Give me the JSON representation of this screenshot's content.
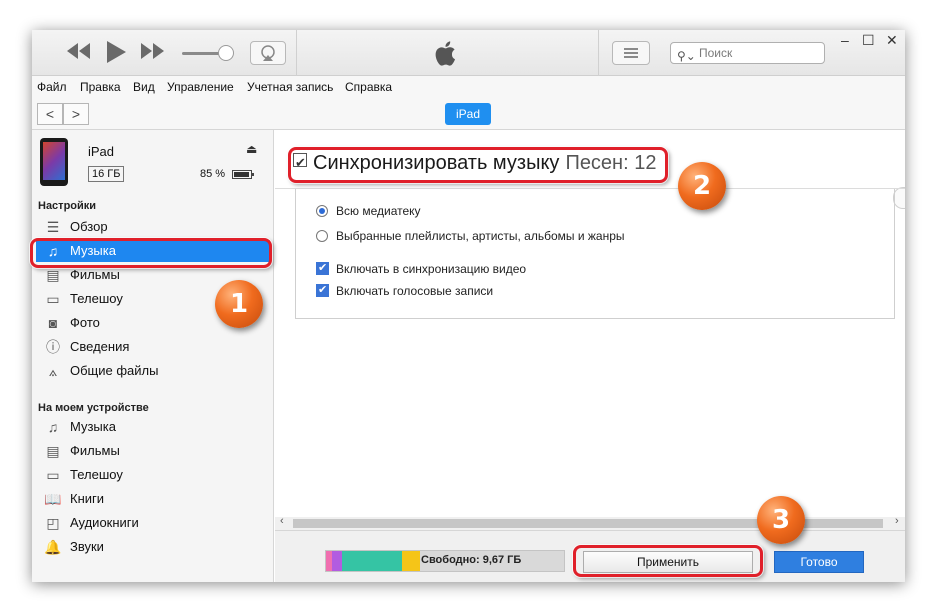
{
  "toolbar": {
    "rewind_icon": "rewind-icon",
    "play_icon": "play-icon",
    "forward_icon": "fast-forward-icon",
    "search_placeholder": "Поиск",
    "window_controls": [
      "–",
      "☐",
      "✕"
    ]
  },
  "menu": [
    "Файл",
    "Правка",
    "Вид",
    "Управление",
    "Учетная запись",
    "Справка"
  ],
  "nav": {
    "back": "<",
    "forward": ">",
    "device_tab": "iPad"
  },
  "device": {
    "name": "iPad",
    "capacity": "16 ГБ",
    "battery": "85 %"
  },
  "sidebar": {
    "settings_header": "Настройки",
    "settings_items": [
      {
        "label": "Обзор",
        "icon": "summary-icon"
      },
      {
        "label": "Музыка",
        "icon": "music-icon"
      },
      {
        "label": "Фильмы",
        "icon": "film-icon"
      },
      {
        "label": "Телешоу",
        "icon": "tv-icon"
      },
      {
        "label": "Фото",
        "icon": "camera-icon"
      },
      {
        "label": "Сведения",
        "icon": "info-icon"
      },
      {
        "label": "Общие файлы",
        "icon": "apps-icon"
      }
    ],
    "device_header": "На моем устройстве",
    "device_items": [
      {
        "label": "Музыка",
        "icon": "music-icon"
      },
      {
        "label": "Фильмы",
        "icon": "film-icon"
      },
      {
        "label": "Телешоу",
        "icon": "tv-icon"
      },
      {
        "label": "Книги",
        "icon": "book-icon"
      },
      {
        "label": "Аудиокниги",
        "icon": "audiobook-icon"
      },
      {
        "label": "Звуки",
        "icon": "bell-icon"
      }
    ]
  },
  "main": {
    "sync_label": "Синхронизировать музыку",
    "song_count": "Песен: 12",
    "options": {
      "entire_library": "Всю медиатеку",
      "selected": "Выбранные плейлисты, артисты, альбомы и жанры",
      "include_video": "Включать в синхронизацию видео",
      "include_voice": "Включать голосовые записи"
    }
  },
  "bottom": {
    "free_label": "Свободно: 9,67 ГБ",
    "apply": "Применить",
    "done": "Готово",
    "storage_colors": [
      "#f06fb0",
      "#b25ce0",
      "#35c4a4",
      "#f5c518"
    ]
  },
  "annotations": {
    "badge1": "1",
    "badge2": "2",
    "badge3": "3"
  }
}
